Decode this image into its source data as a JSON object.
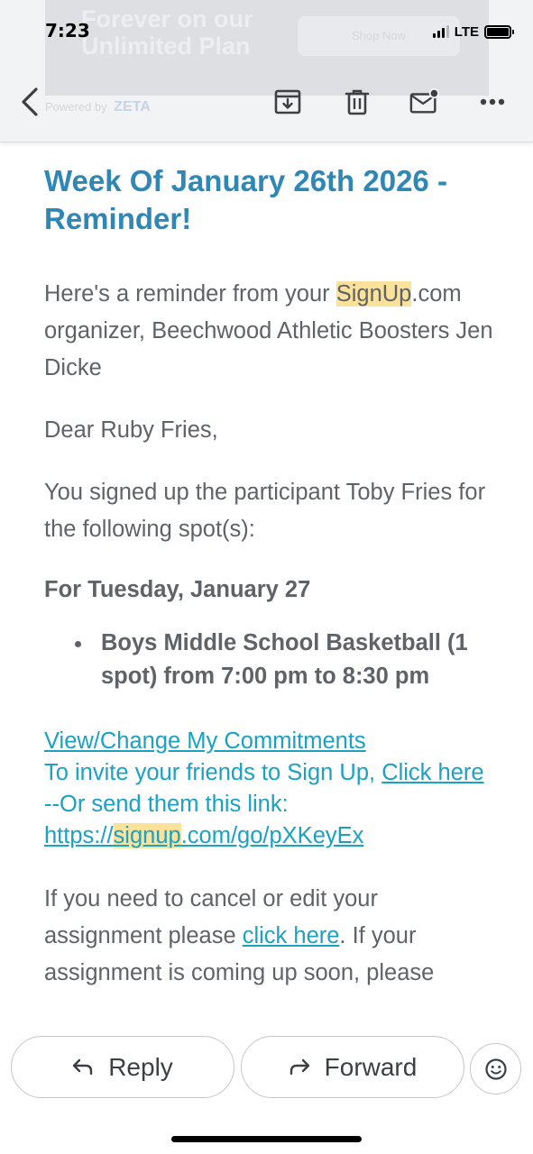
{
  "status_bar": {
    "time": "7:23",
    "network": "LTE",
    "signal_bars": 3,
    "battery_level": 1.0
  },
  "ad": {
    "headline": "Forever on our Unlimited Plan",
    "cta": "Shop Now",
    "powered_by": "Powered by",
    "brand": "ZETA"
  },
  "toolbar": {
    "icons": [
      "back-chevron-icon",
      "archive-icon",
      "trash-icon",
      "mark-unread-icon",
      "more-icon"
    ]
  },
  "email": {
    "subject": "Week Of January 26th 2026 - Reminder!",
    "intro": {
      "before": "Here's a reminder from your ",
      "highlight": "SignUp",
      "after": ".com organizer, Beechwood Athletic Boosters Jen Dicke"
    },
    "greeting": "Dear Ruby Fries,",
    "signed_up": "You signed up the participant Toby Fries for the following spot(s):",
    "date_heading": "For Tuesday, January 27",
    "spots": [
      "Boys Middle School Basketball (1 spot) from 7:00 pm to 8:30 pm"
    ],
    "links": {
      "view_change": "View/Change My Commitments",
      "invite_prefix": "To invite your friends to Sign Up, ",
      "click_here": "Click here",
      "or_send": "--Or send them this link:",
      "url_prefix": "https://",
      "url_highlight": "signup",
      "url_suffix": ".com/go/pXKeyEx"
    },
    "cancel": {
      "before": "If you need to cancel or edit your assignment please ",
      "link": "click here",
      "after": ". If your assignment is coming up soon, please"
    }
  },
  "actions": {
    "reply": "Reply",
    "forward": "Forward"
  },
  "colors": {
    "subject": "#2f87b5",
    "link": "#1aa1c4",
    "highlight": "#fbe29a",
    "body_text": "#5f6368"
  }
}
